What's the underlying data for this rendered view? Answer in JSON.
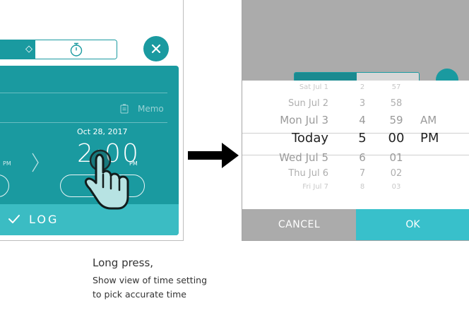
{
  "before": {
    "memo_label": "Memo",
    "date": "Oct 28, 2017",
    "time": "2:00",
    "ampm": "PM",
    "ampm_left": "PM",
    "log_label": "LOG",
    "icons": [
      "sun-icon",
      "stopwatch-icon",
      "close-icon",
      "memo-icon",
      "chevron-right-icon",
      "check-icon",
      "hand-pointer-icon"
    ],
    "colors": {
      "teal": "#1a9aa0",
      "log_bar": "#3bbcc3"
    }
  },
  "picker": {
    "rows": [
      {
        "day": "Sat Jul 1",
        "hour": "2",
        "minute": "57",
        "ampm": ""
      },
      {
        "day": "Sun Jul 2",
        "hour": "3",
        "minute": "58",
        "ampm": ""
      },
      {
        "day": "Mon Jul 3",
        "hour": "4",
        "minute": "59",
        "ampm": "AM"
      },
      {
        "day": "Today",
        "hour": "5",
        "minute": "00",
        "ampm": "PM"
      },
      {
        "day": "Wed Jul 5",
        "hour": "6",
        "minute": "01",
        "ampm": ""
      },
      {
        "day": "Thu Jul 6",
        "hour": "7",
        "minute": "02",
        "ampm": ""
      },
      {
        "day": "Fri Jul 7",
        "hour": "8",
        "minute": "03",
        "ampm": ""
      }
    ],
    "selected_index": 3,
    "cancel_label": "CANCEL",
    "ok_label": "OK",
    "colors": {
      "ok_bg": "#38c0cb",
      "cancel_bg": "#ababab",
      "dim_overlay": "#ababab"
    }
  },
  "caption": {
    "title": "Long press,",
    "line1": "Show view of time setting",
    "line2": "to pick accurate time"
  }
}
